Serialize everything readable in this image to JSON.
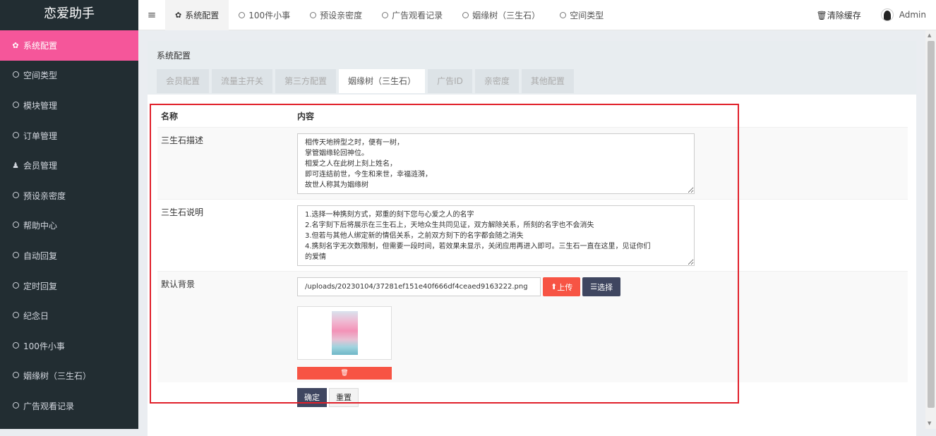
{
  "app": {
    "title": "恋爱助手"
  },
  "sidebar": {
    "items": [
      {
        "label": "系统配置",
        "icon": "gear-icon"
      },
      {
        "label": "空间类型",
        "icon": "circle-icon"
      },
      {
        "label": "模块管理",
        "icon": "circle-icon"
      },
      {
        "label": "订单管理",
        "icon": "circle-icon"
      },
      {
        "label": "会员管理",
        "icon": "user-icon"
      },
      {
        "label": "预设亲密度",
        "icon": "circle-icon"
      },
      {
        "label": "帮助中心",
        "icon": "circle-icon"
      },
      {
        "label": "自动回复",
        "icon": "circle-icon"
      },
      {
        "label": "定时回复",
        "icon": "circle-icon"
      },
      {
        "label": "纪念日",
        "icon": "circle-icon"
      },
      {
        "label": "100件小事",
        "icon": "circle-icon"
      },
      {
        "label": "姻缘树（三生石）",
        "icon": "circle-icon"
      },
      {
        "label": "广告观看记录",
        "icon": "circle-icon"
      }
    ],
    "active_index": 0,
    "active_color": "#f5569a"
  },
  "topbar": {
    "tabs": [
      "系统配置",
      "100件小事",
      "预设亲密度",
      "广告观看记录",
      "姻缘树（三生石）",
      "空间类型"
    ],
    "clear_cache": "清除缓存",
    "user": "Admin"
  },
  "panel": {
    "title": "系统配置",
    "tabs": [
      "会员配置",
      "流量主开关",
      "第三方配置",
      "姻缘树（三生石）",
      "广告ID",
      "亲密度",
      "其他配置"
    ],
    "active_tab": 3
  },
  "form": {
    "col_name": "名称",
    "col_content": "内容",
    "desc_label": "三生石描述",
    "desc_value": "相传天地辨型之时，便有一树，\n掌管姻缘轮回神位。\n相爱之人在此树上刻上姓名，\n即可连结前世，今生和来世，幸福涟漪，\n故世人称其为姻缘树",
    "note_label": "三生石说明",
    "note_value": "1.选择一种携刻方式，郑重的刻下您与心爱之人的名字\n2.名字刻下后将展示在三生石上，天地众生共同见证，双方解除关系，所刻的名字也不会消失\n3.但若与其他人绑定新的情侣关系，之前双方刻下的名字都会随之消失\n4.携刻名字无次数限制，但需要一段时间，若效果未显示，关闭应用再进入即可。三生石一直在这里，见证你们\n的爱情",
    "bg_label": "默认背景",
    "bg_value": "/uploads/20230104/37281ef151e40f666df4ceaed9163222.png",
    "upload_btn": "上传",
    "select_btn": "选择",
    "confirm_btn": "确定",
    "reset_btn": "重置"
  },
  "colors": {
    "danger": "#f75444",
    "dark": "#3f4660",
    "highlight_border": "#e0202a"
  }
}
